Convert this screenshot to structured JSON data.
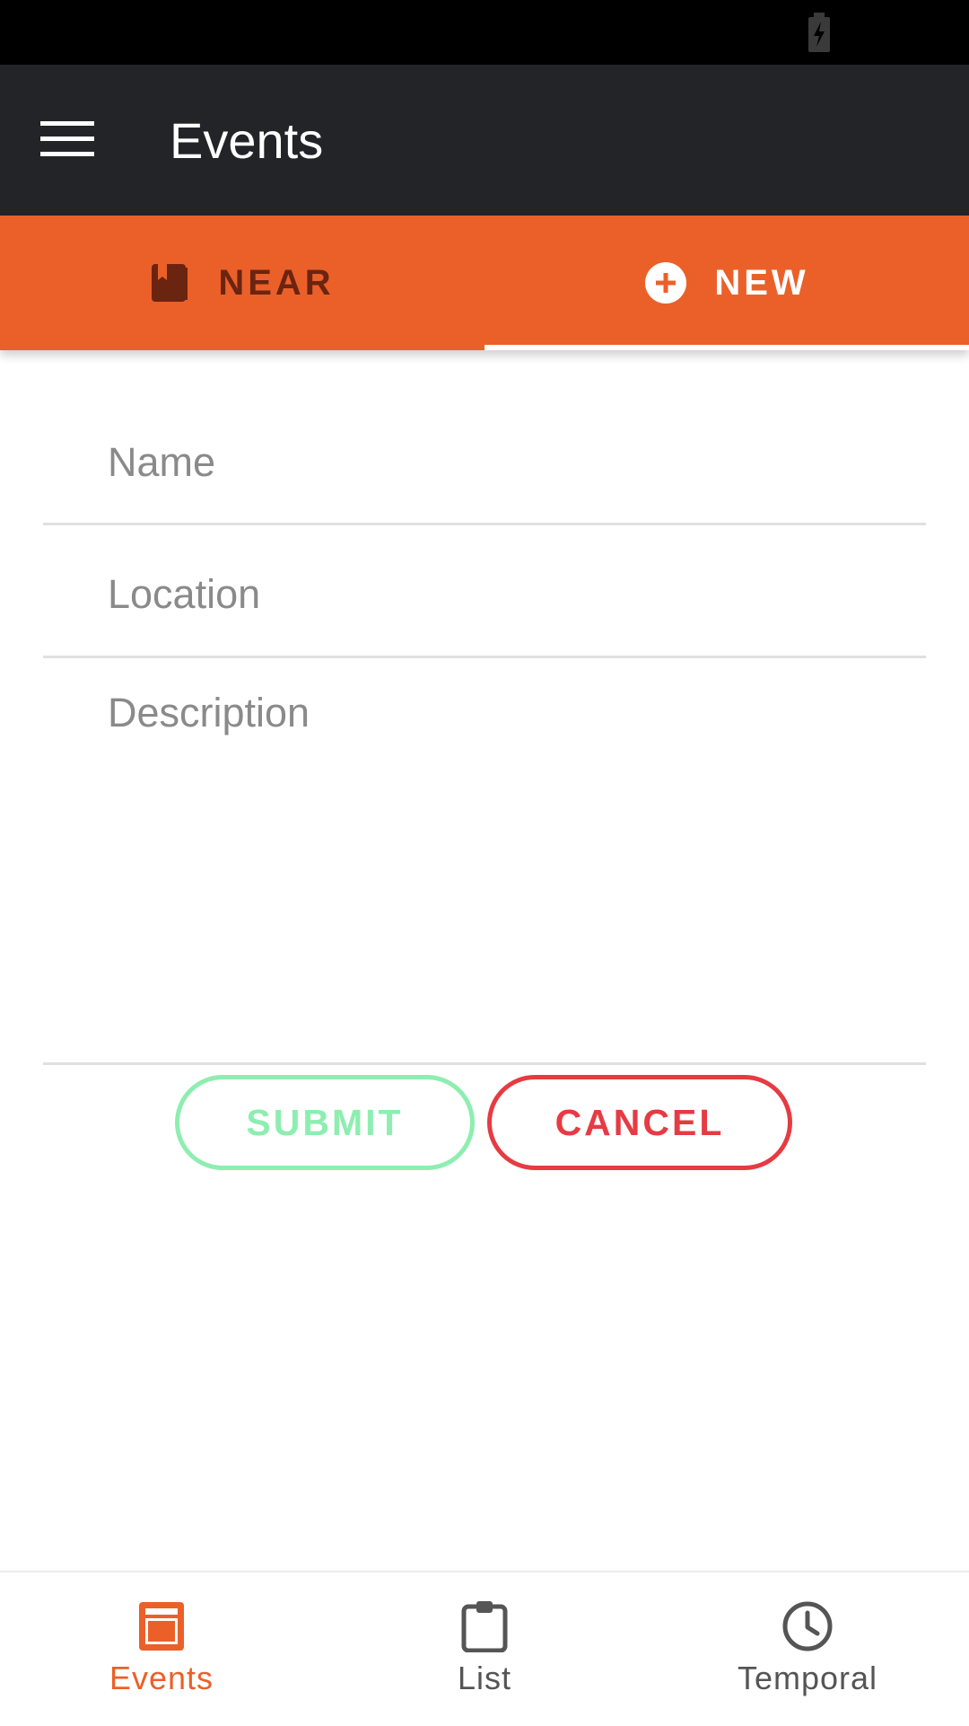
{
  "app_bar": {
    "title": "Events"
  },
  "tabs": [
    {
      "label": "NEAR",
      "icon": "book-icon",
      "selected": false
    },
    {
      "label": "NEW",
      "icon": "add-circle-icon",
      "selected": true
    }
  ],
  "form": {
    "name": {
      "placeholder": "Name",
      "value": ""
    },
    "location": {
      "placeholder": "Location",
      "value": ""
    },
    "description": {
      "placeholder": "Description",
      "value": ""
    }
  },
  "buttons": {
    "submit_label": "SUBMIT",
    "cancel_label": "CANCEL"
  },
  "bottom_nav": {
    "items": [
      {
        "label": "Events",
        "icon": "events-icon",
        "active": true
      },
      {
        "label": "List",
        "icon": "clipboard-icon",
        "active": false
      },
      {
        "label": "Temporal",
        "icon": "clock-icon",
        "active": false
      }
    ]
  },
  "colors": {
    "toolbar": "#222428",
    "accent": "#eb6029",
    "submit": "#8deeb0",
    "cancel": "#e63b43"
  }
}
